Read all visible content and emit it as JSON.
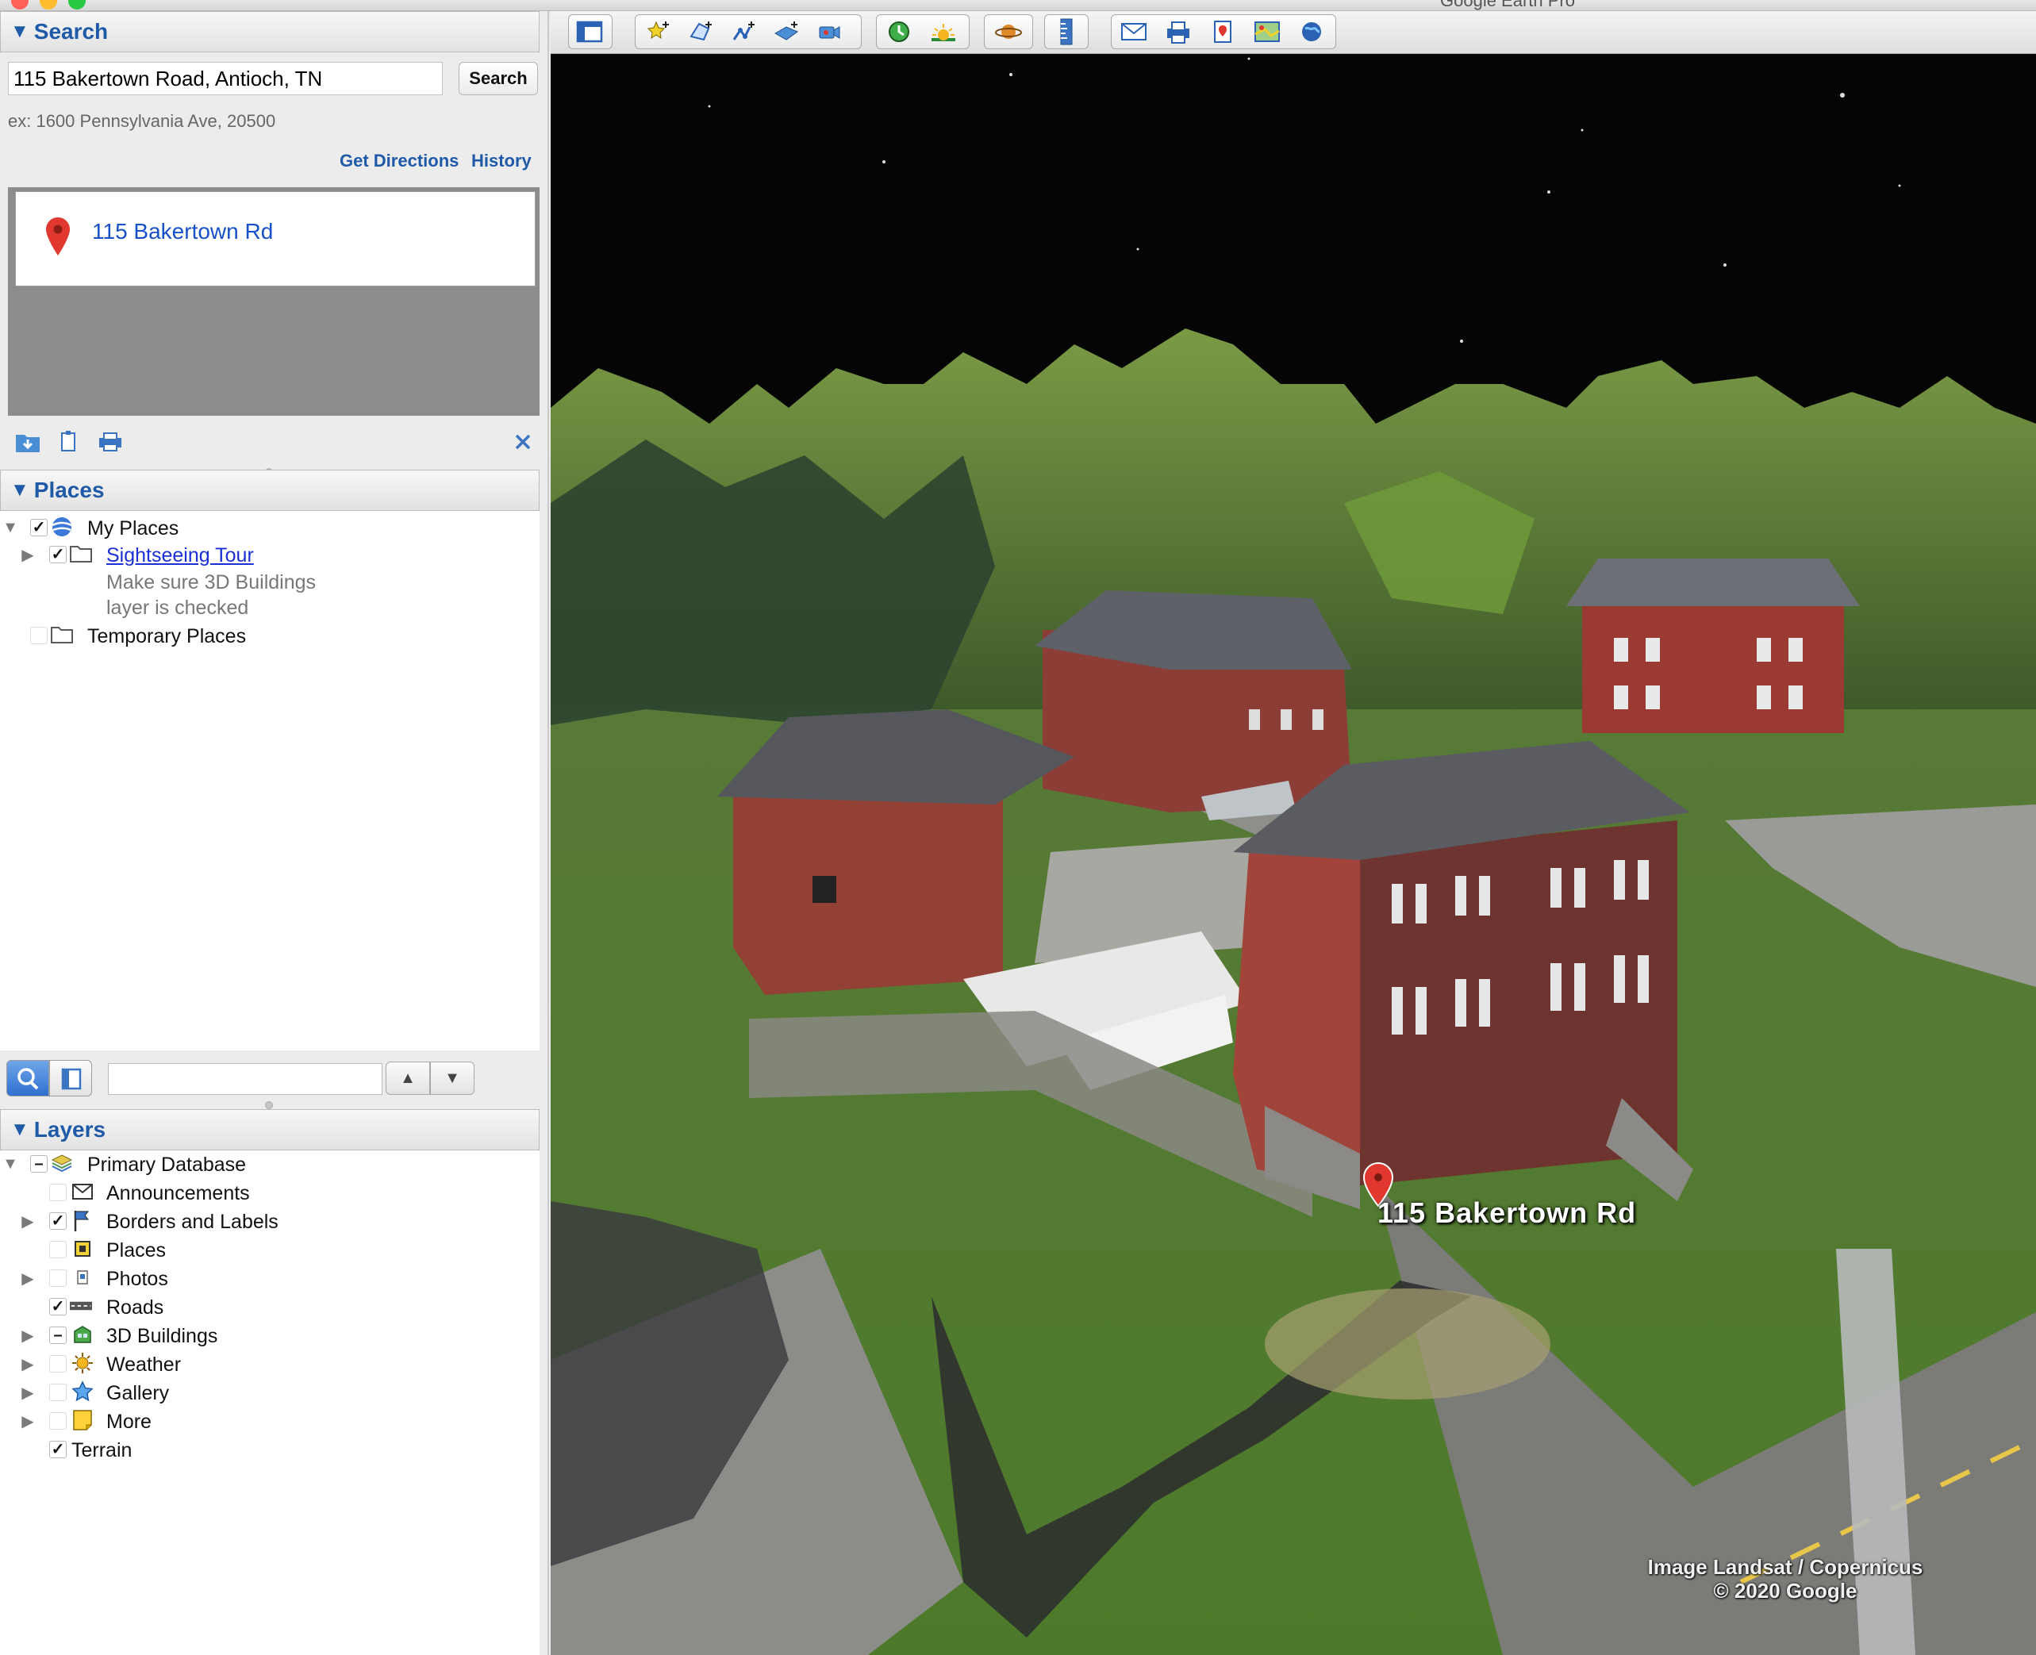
{
  "window": {
    "title": "Google Earth Pro"
  },
  "search": {
    "header": "Search",
    "query": "115 Bakertown Road, Antioch, TN",
    "button_label": "Search",
    "example": "ex: 1600 Pennsylvania Ave, 20500",
    "get_directions": "Get Directions",
    "history": "History",
    "result": "115 Bakertown Rd"
  },
  "places": {
    "header": "Places",
    "my_places": "My Places",
    "sightseeing_tour": "Sightseeing Tour",
    "tour_note_1": "Make sure 3D Buildings",
    "tour_note_2": "layer is checked",
    "temporary_places": "Temporary Places"
  },
  "layers": {
    "header": "Layers",
    "primary_database": "Primary Database",
    "items": [
      {
        "label": "Announcements",
        "checked": false
      },
      {
        "label": "Borders and Labels",
        "checked": true
      },
      {
        "label": "Places",
        "checked": false
      },
      {
        "label": "Photos",
        "checked": false
      },
      {
        "label": "Roads",
        "checked": true
      },
      {
        "label": "3D Buildings",
        "checked": "partial"
      },
      {
        "label": "Weather",
        "checked": false
      },
      {
        "label": "Gallery",
        "checked": false
      },
      {
        "label": "More",
        "checked": false
      }
    ],
    "terrain": "Terrain"
  },
  "map": {
    "placemark_label": "115 Bakertown Rd",
    "attribution_1": "Image Landsat / Copernicus",
    "attribution_2": "© 2020 Google"
  },
  "colors": {
    "accent": "#1e5aa8",
    "link": "#1b2fd6",
    "pin_red": "#e0382e"
  },
  "toolbar_icons": [
    "sidebar-toggle-icon",
    "add-placemark-icon",
    "add-polygon-icon",
    "add-path-icon",
    "add-image-overlay-icon",
    "record-tour-icon",
    "historical-imagery-icon",
    "sunlight-icon",
    "planet-icon",
    "ruler-icon",
    "email-icon",
    "print-icon",
    "save-image-icon",
    "view-in-maps-icon",
    "earth-icon"
  ]
}
